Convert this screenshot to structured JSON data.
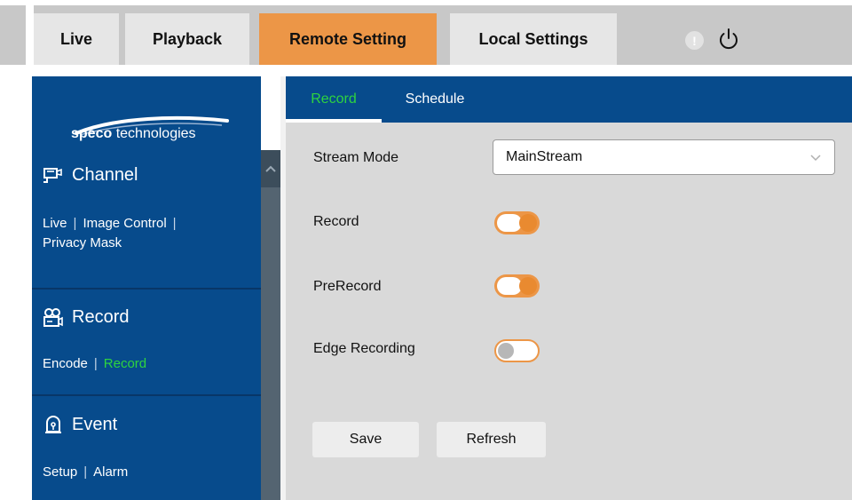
{
  "top_tabs": [
    {
      "label": "Live"
    },
    {
      "label": "Playback"
    },
    {
      "label": "Remote Setting"
    },
    {
      "label": "Local Settings"
    }
  ],
  "top_icons": {
    "alert": "!",
    "alert_name": "info-alert-icon",
    "power_name": "power-icon"
  },
  "colors": {
    "accent": "#ec9647",
    "sidebar": "#074b8c",
    "active_link": "#2ed43f",
    "panel": "#d9d9d9"
  },
  "logo": {
    "brand": "speco",
    "rest": " technologies"
  },
  "sidebar": {
    "sections": [
      {
        "title": "Channel",
        "icon": "camera-icon",
        "links": [
          "Live",
          "Image Control",
          "Privacy Mask"
        ]
      },
      {
        "title": "Record",
        "icon": "video-camera-icon",
        "links": [
          "Encode",
          "Record"
        ],
        "active_link": "Record"
      },
      {
        "title": "Event",
        "icon": "alarm-icon",
        "links": [
          "Setup",
          "Alarm"
        ]
      }
    ]
  },
  "subtabs": [
    {
      "label": "Record"
    },
    {
      "label": "Schedule"
    }
  ],
  "form": {
    "stream_mode_label": "Stream Mode",
    "stream_mode_value": "MainStream",
    "record_label": "Record",
    "record_on": true,
    "prerecord_label": "PreRecord",
    "prerecord_on": true,
    "edge_label": "Edge Recording",
    "edge_on": false
  },
  "buttons": {
    "save": "Save",
    "refresh": "Refresh"
  }
}
